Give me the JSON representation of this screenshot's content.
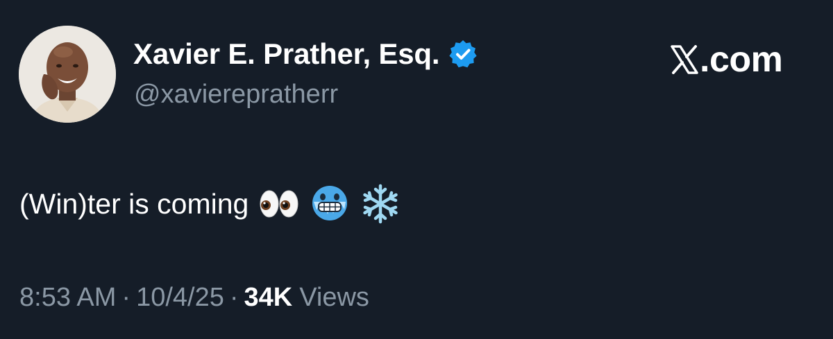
{
  "tweet": {
    "display_name": "Xavier E. Prather, Esq.",
    "handle": "@xavierepratherr",
    "verified": true,
    "text": "(Win)ter is coming",
    "emojis": [
      "eyes-icon",
      "cold-face-icon",
      "snowflake-icon"
    ]
  },
  "brand": {
    "text": ".com",
    "icon": "x-logo-icon"
  },
  "meta": {
    "time": "8:53 AM",
    "separator": "·",
    "date": "10/4/25",
    "views_count": "34K",
    "views_label": "Views"
  },
  "colors": {
    "background": "#151d28",
    "text": "#ffffff",
    "secondary": "#8b98a5",
    "verified": "#1d9bf0"
  }
}
